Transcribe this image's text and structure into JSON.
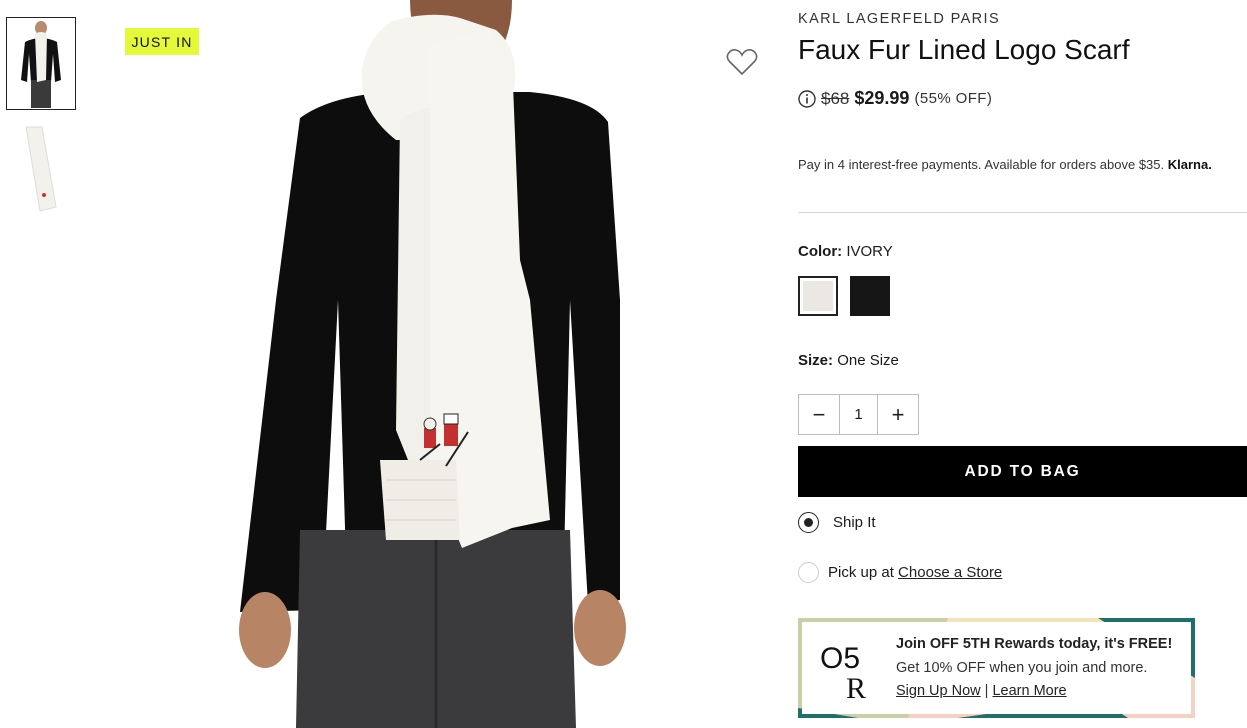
{
  "gallery": {
    "badge": "JUST IN"
  },
  "product": {
    "brand": "KARL LAGERFELD PARIS",
    "title": "Faux Fur Lined Logo Scarf",
    "original_price": "$68",
    "sale_price": "$29.99",
    "discount": "(55% OFF)"
  },
  "klarna": {
    "text": "Pay in 4 interest-free payments. Available for orders above $35.",
    "brand": "Klarna."
  },
  "color": {
    "label": "Color:",
    "selected": "IVORY",
    "swatches": [
      "#ebe7e2",
      "#161616"
    ]
  },
  "size": {
    "label": "Size:",
    "value": "One Size"
  },
  "quantity": {
    "minus": "−",
    "value": "1",
    "plus": "+"
  },
  "cart": {
    "add_label": "ADD TO BAG"
  },
  "fulfillment": {
    "ship_label": "Ship It",
    "pickup_prefix": "Pick up at",
    "pickup_link": "Choose a Store"
  },
  "rewards": {
    "logo_top": "O5",
    "logo_bottom": "R",
    "heading": "Join OFF 5TH Rewards today, it's FREE!",
    "subtext": "Get 10% OFF when you join and more.",
    "signup": "Sign Up Now",
    "separator": "|",
    "learn": "Learn More",
    "border_colors": [
      "#1f6f6b",
      "#f3d2c3",
      "#f4e3b8",
      "#c9cfa6"
    ]
  }
}
